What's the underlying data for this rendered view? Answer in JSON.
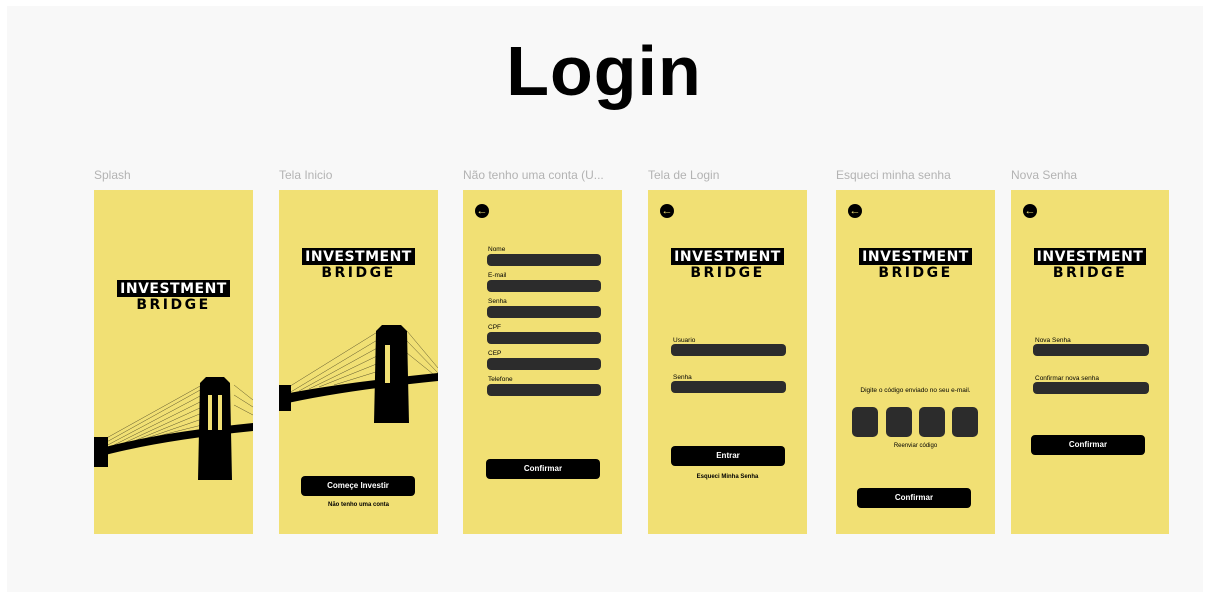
{
  "page": {
    "title": "Login"
  },
  "colors": {
    "screen_bg": "#f1e074",
    "field": "#2c2c2c",
    "button": "#000000",
    "label": "#b3b3b3"
  },
  "frames": [
    {
      "label": "Splash"
    },
    {
      "label": "Tela Inicio"
    },
    {
      "label": "Não tenho uma conta (U..."
    },
    {
      "label": "Tela de Login"
    },
    {
      "label": "Esqueci minha senha"
    },
    {
      "label": "Nova Senha"
    }
  ],
  "logo": {
    "line1": "INVESTMENT",
    "line2": "BRIDGE"
  },
  "tela_inicio": {
    "start_button": "Começe Investir",
    "no_account_link": "Não tenho uma conta"
  },
  "cadastro": {
    "fields": [
      "Nome",
      "E-mail",
      "Senha",
      "CPF",
      "CEP",
      "Telefone"
    ],
    "confirm_button": "Confirmar"
  },
  "login": {
    "user_label": "Usuario",
    "password_label": "Senha",
    "enter_button": "Entrar",
    "forgot_link": "Esqueci Minha Senha"
  },
  "esqueci": {
    "instruction": "Digite o código enviado no seu e-mail.",
    "resend_link": "Reenviar código",
    "confirm_button": "Confirmar"
  },
  "nova_senha": {
    "new_label": "Nova Senha",
    "confirm_label": "Confirmar nova senha",
    "confirm_button": "Confirmar"
  },
  "icons": {
    "back": "arrow-left-icon",
    "bridge": "bridge-silhouette-icon"
  }
}
